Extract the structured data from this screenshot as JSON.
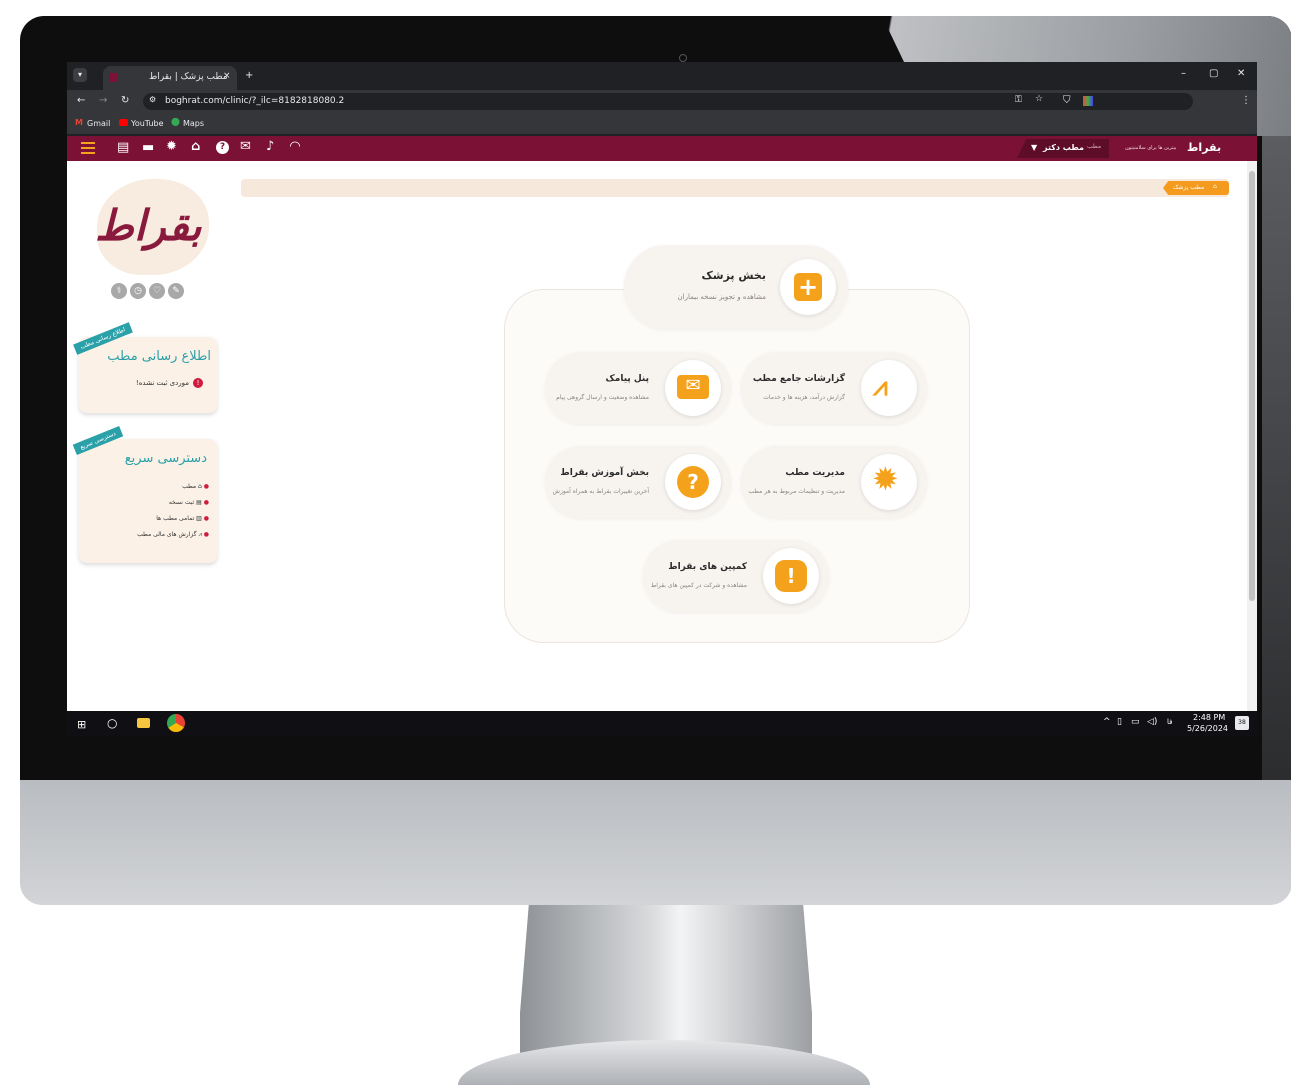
{
  "browser": {
    "tab_title": "مطب پزشک | بقراط",
    "tab_close": "×",
    "url": "boghrat.com/clinic/?_ilc=8182818080.2",
    "bookmarks": [
      "Gmail",
      "YouTube",
      "Maps"
    ],
    "window_controls": [
      "–",
      "▢",
      "✕"
    ]
  },
  "appbar": {
    "brand": "بقراط",
    "brand_sub": "بیترین ها برای سلامتیتون",
    "dropdown_label": "مطب دکتر",
    "dropdown_prefix": "مطب"
  },
  "breadcrumb": {
    "label": "مطب پزشک"
  },
  "main": {
    "top": {
      "title": "بخش پزشک",
      "subtitle": "مشاهده و تجویز نسخه بیماران"
    },
    "cards": [
      {
        "title": "گزارشات جامع مطب",
        "subtitle": "گزارش درآمد، هزینه ها و خدمات"
      },
      {
        "title": "پنل پیامک",
        "subtitle": "مشاهده وضعیت و ارسال گروهی پیام"
      },
      {
        "title": "مدیریت مطب",
        "subtitle": "مدیریت و تنظیمات مربوط به هر مطب"
      },
      {
        "title": "بخش آموزش بقراط",
        "subtitle": "آخرین تغییرات بقراط به همراه آموزش"
      },
      {
        "title": "کمپین های بقراط",
        "subtitle": "مشاهده و شرکت در کمپین های بقراط"
      }
    ]
  },
  "sidebar": {
    "logo_text": "بقراط",
    "info": {
      "ribbon": "اطلاع رسانی مطب",
      "title": "اطلاع رسانی مطب",
      "empty": "موردی ثبت نشده!"
    },
    "quick": {
      "ribbon": "دسترسی سریع",
      "title": "دسترسی سریع",
      "items": [
        "مطب",
        "ثبت نسخه",
        "تمامی مطب ها",
        "گزارش های مالی مطب"
      ]
    }
  },
  "taskbar": {
    "time": "2:48 PM",
    "date": "5/26/2024",
    "lang": "فا",
    "notif_count": "38"
  },
  "colors": {
    "brand": "#7b1235",
    "accent": "#f4a21b",
    "ribbon": "#2aa0a8",
    "card_bg": "#f7f4f0"
  }
}
